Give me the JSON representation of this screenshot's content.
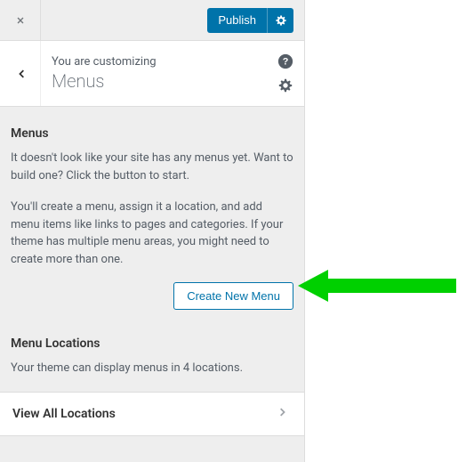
{
  "topbar": {
    "publish_label": "Publish"
  },
  "header": {
    "customizing_label": "You are customizing",
    "title": "Menus"
  },
  "menus": {
    "heading": "Menus",
    "intro": "It doesn't look like your site has any menus yet. Want to build one? Click the button to start.",
    "details": "You'll create a menu, assign it a location, and add menu items like links to pages and categories. If your theme has multiple menu areas, you might need to create more than one.",
    "create_label": "Create New Menu"
  },
  "locations": {
    "heading": "Menu Locations",
    "description": "Your theme can display menus in 4 locations.",
    "view_all_label": "View All Locations"
  }
}
